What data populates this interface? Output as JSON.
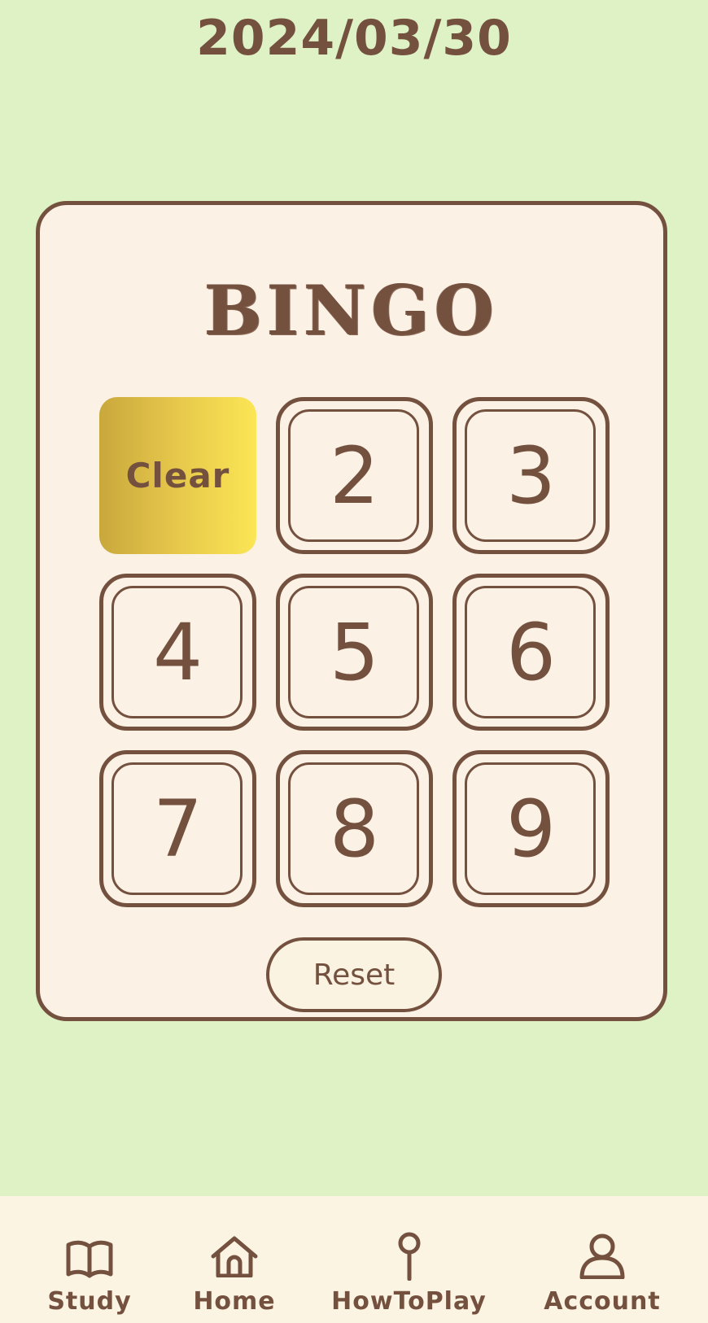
{
  "header": {
    "date": "2024/03/30"
  },
  "bingo": {
    "title": "BINGO",
    "cells": [
      {
        "label": "Clear",
        "state": "cleared"
      },
      {
        "label": "2",
        "state": "open"
      },
      {
        "label": "3",
        "state": "open"
      },
      {
        "label": "4",
        "state": "open"
      },
      {
        "label": "5",
        "state": "open"
      },
      {
        "label": "6",
        "state": "open"
      },
      {
        "label": "7",
        "state": "open"
      },
      {
        "label": "8",
        "state": "open"
      },
      {
        "label": "9",
        "state": "open"
      }
    ],
    "reset_label": "Reset"
  },
  "tabbar": {
    "tabs": [
      {
        "label": "Study",
        "icon": "book-icon"
      },
      {
        "label": "Home",
        "icon": "home-icon"
      },
      {
        "label": "HowToPlay",
        "icon": "pin-icon"
      },
      {
        "label": "Account",
        "icon": "person-icon"
      }
    ]
  },
  "colors": {
    "background": "#dff2c6",
    "card": "#fbf1e5",
    "ink": "#74513f",
    "clear_gradient_start": "#c9a83c",
    "clear_gradient_end": "#fbe655",
    "tabbar": "#fcf4e3"
  }
}
